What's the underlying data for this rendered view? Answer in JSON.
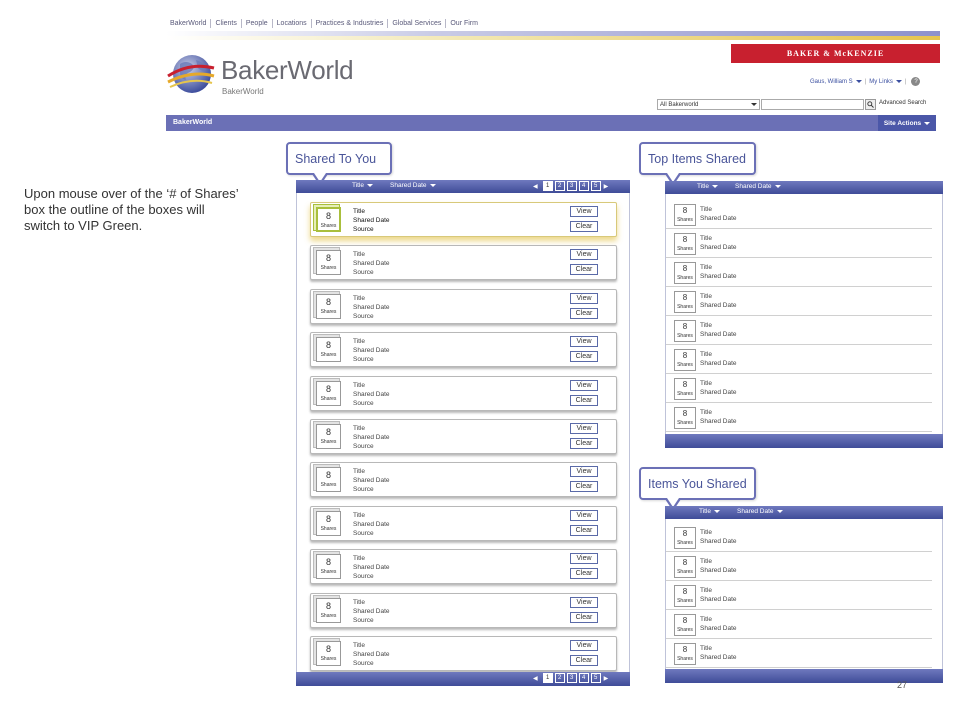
{
  "nav": [
    "BakerWorld",
    "Clients",
    "People",
    "Locations",
    "Practices & Industries",
    "Global Services",
    "Our Firm"
  ],
  "brand": "BAKER & McKENZIE",
  "logo": {
    "title": "BakerWorld",
    "subtitle": "BakerWorld"
  },
  "user": {
    "name": "Gaus, William S",
    "my_links": "My Links",
    "help": "?"
  },
  "search": {
    "scope": "All Bakerworld",
    "value": "",
    "advanced": "Advanced Search"
  },
  "bar": {
    "label": "BakerWorld",
    "site_actions": "Site Actions"
  },
  "annotation": "Upon mouse over of the ‘# of Shares’ box the outline of the boxes will switch to VIP Green.",
  "colors": {
    "accent_blue": "#6b70b6",
    "vip_green": "#a9bf3c",
    "brand_red": "#c8202f"
  },
  "shared_to_you": {
    "title": "Shared To You",
    "sort": [
      "Title",
      "Shared Date"
    ],
    "pager": [
      "1",
      "2",
      "3",
      "4",
      "5"
    ],
    "active_page": 0,
    "items": [
      {
        "count": "8",
        "unit": "Shares",
        "title": "Title",
        "date": "Shared Date",
        "source": "Source",
        "view": "View",
        "clear": "Clear",
        "hover": true
      },
      {
        "count": "8",
        "unit": "Shares",
        "title": "Title",
        "date": "Shared Date",
        "source": "Source",
        "view": "View",
        "clear": "Clear"
      },
      {
        "count": "8",
        "unit": "Shares",
        "title": "Title",
        "date": "Shared Date",
        "source": "Source",
        "view": "View",
        "clear": "Clear"
      },
      {
        "count": "8",
        "unit": "Shares",
        "title": "Title",
        "date": "Shared Date",
        "source": "Source",
        "view": "View",
        "clear": "Clear"
      },
      {
        "count": "8",
        "unit": "Shares",
        "title": "Title",
        "date": "Shared Date",
        "source": "Source",
        "view": "View",
        "clear": "Clear"
      },
      {
        "count": "8",
        "unit": "Shares",
        "title": "Title",
        "date": "Shared Date",
        "source": "Source",
        "view": "View",
        "clear": "Clear"
      },
      {
        "count": "8",
        "unit": "Shares",
        "title": "Title",
        "date": "Shared Date",
        "source": "Source",
        "view": "View",
        "clear": "Clear"
      },
      {
        "count": "8",
        "unit": "Shares",
        "title": "Title",
        "date": "Shared Date",
        "source": "Source",
        "view": "View",
        "clear": "Clear"
      },
      {
        "count": "8",
        "unit": "Shares",
        "title": "Title",
        "date": "Shared Date",
        "source": "Source",
        "view": "View",
        "clear": "Clear"
      },
      {
        "count": "8",
        "unit": "Shares",
        "title": "Title",
        "date": "Shared Date",
        "source": "Source",
        "view": "View",
        "clear": "Clear"
      },
      {
        "count": "8",
        "unit": "Shares",
        "title": "Title",
        "date": "Shared Date",
        "source": "Source",
        "view": "View",
        "clear": "Clear"
      }
    ]
  },
  "top_items": {
    "title": "Top Items Shared",
    "sort": [
      "Title",
      "Shared Date"
    ],
    "items": [
      {
        "count": "8",
        "unit": "Shares",
        "title": "Title",
        "date": "Shared Date"
      },
      {
        "count": "8",
        "unit": "Shares",
        "title": "Title",
        "date": "Shared Date"
      },
      {
        "count": "8",
        "unit": "Shares",
        "title": "Title",
        "date": "Shared Date"
      },
      {
        "count": "8",
        "unit": "Shares",
        "title": "Title",
        "date": "Shared Date"
      },
      {
        "count": "8",
        "unit": "Shares",
        "title": "Title",
        "date": "Shared Date"
      },
      {
        "count": "8",
        "unit": "Shares",
        "title": "Title",
        "date": "Shared Date"
      },
      {
        "count": "8",
        "unit": "Shares",
        "title": "Title",
        "date": "Shared Date"
      },
      {
        "count": "8",
        "unit": "Shares",
        "title": "Title",
        "date": "Shared Date"
      }
    ]
  },
  "items_you_shared": {
    "title": "Items You Shared",
    "sort": [
      "Title",
      "Shared Date"
    ],
    "items": [
      {
        "count": "8",
        "unit": "Shares",
        "title": "Title",
        "date": "Shared Date"
      },
      {
        "count": "8",
        "unit": "Shares",
        "title": "Title",
        "date": "Shared Date"
      },
      {
        "count": "8",
        "unit": "Shares",
        "title": "Title",
        "date": "Shared Date"
      },
      {
        "count": "8",
        "unit": "Shares",
        "title": "Title",
        "date": "Shared Date"
      },
      {
        "count": "8",
        "unit": "Shares",
        "title": "Title",
        "date": "Shared Date"
      }
    ]
  },
  "page_number": "27"
}
